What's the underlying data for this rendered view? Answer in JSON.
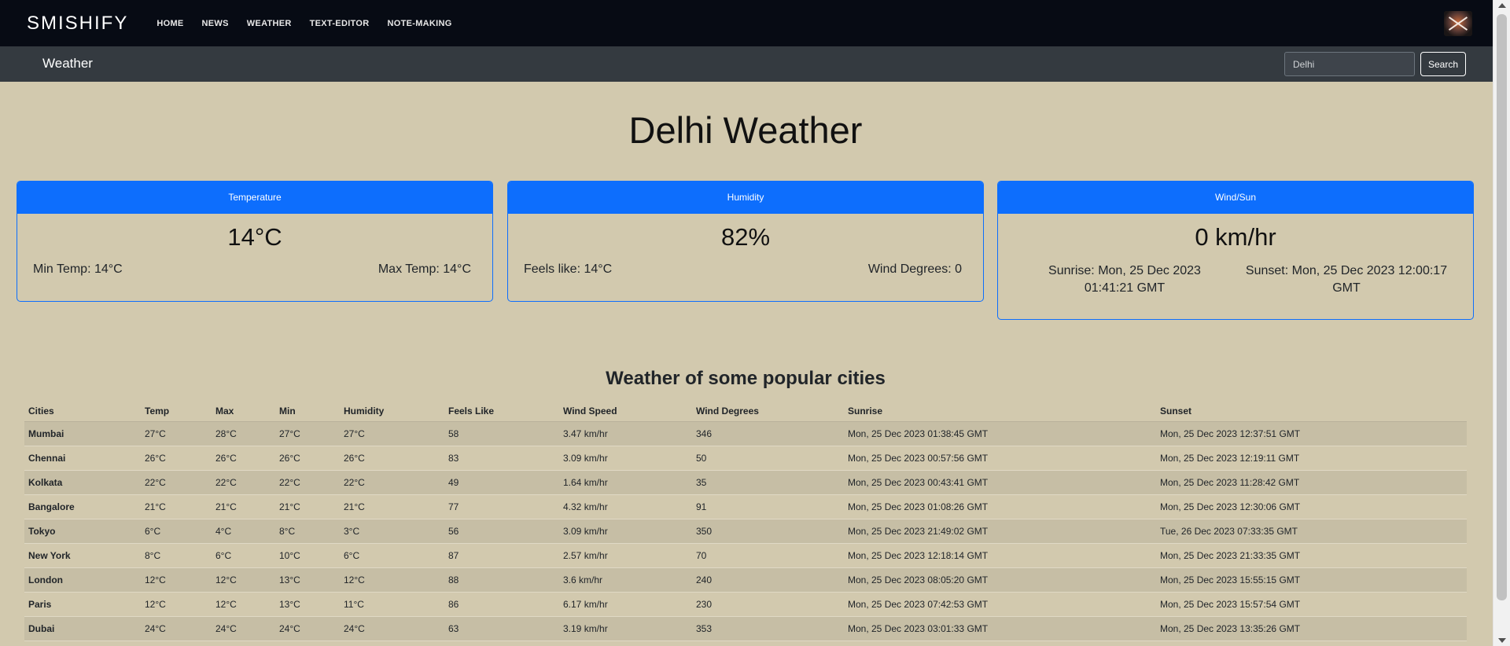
{
  "navbar": {
    "brand": "SMISHIFY",
    "links": [
      "HOME",
      "NEWS",
      "WEATHER",
      "TEXT-EDITOR",
      "NOTE-MAKING"
    ]
  },
  "subbar": {
    "title": "Weather",
    "search_value": "Delhi",
    "search_button": "Search"
  },
  "page_title": "Delhi Weather",
  "cards": {
    "temperature": {
      "header": "Temperature",
      "main": "14°C",
      "left": "Min Temp: 14°C",
      "right": "Max Temp: 14°C"
    },
    "humidity": {
      "header": "Humidity",
      "main": "82%",
      "left": "Feels like: 14°C",
      "right": "Wind Degrees: 0"
    },
    "wind": {
      "header": "Wind/Sun",
      "main": "0 km/hr",
      "left": "Sunrise: Mon, 25 Dec 2023 01:41:21 GMT",
      "right": "Sunset: Mon, 25 Dec 2023 12:00:17 GMT"
    }
  },
  "section_title": "Weather of some popular cities",
  "table": {
    "headers": [
      "Cities",
      "Temp",
      "Max",
      "Min",
      "Humidity",
      "Feels Like",
      "Wind Speed",
      "Wind Degrees",
      "Sunrise",
      "Sunset"
    ],
    "rows": [
      [
        "Mumbai",
        "27°C",
        "28°C",
        "27°C",
        "27°C",
        "58",
        "3.47 km/hr",
        "346",
        "Mon, 25 Dec 2023 01:38:45 GMT",
        "Mon, 25 Dec 2023 12:37:51 GMT"
      ],
      [
        "Chennai",
        "26°C",
        "26°C",
        "26°C",
        "26°C",
        "83",
        "3.09 km/hr",
        "50",
        "Mon, 25 Dec 2023 00:57:56 GMT",
        "Mon, 25 Dec 2023 12:19:11 GMT"
      ],
      [
        "Kolkata",
        "22°C",
        "22°C",
        "22°C",
        "22°C",
        "49",
        "1.64 km/hr",
        "35",
        "Mon, 25 Dec 2023 00:43:41 GMT",
        "Mon, 25 Dec 2023 11:28:42 GMT"
      ],
      [
        "Bangalore",
        "21°C",
        "21°C",
        "21°C",
        "21°C",
        "77",
        "4.32 km/hr",
        "91",
        "Mon, 25 Dec 2023 01:08:26 GMT",
        "Mon, 25 Dec 2023 12:30:06 GMT"
      ],
      [
        "Tokyo",
        "6°C",
        "4°C",
        "8°C",
        "3°C",
        "56",
        "3.09 km/hr",
        "350",
        "Mon, 25 Dec 2023 21:49:02 GMT",
        "Tue, 26 Dec 2023 07:33:35 GMT"
      ],
      [
        "New York",
        "8°C",
        "6°C",
        "10°C",
        "6°C",
        "87",
        "2.57 km/hr",
        "70",
        "Mon, 25 Dec 2023 12:18:14 GMT",
        "Mon, 25 Dec 2023 21:33:35 GMT"
      ],
      [
        "London",
        "12°C",
        "12°C",
        "13°C",
        "12°C",
        "88",
        "3.6 km/hr",
        "240",
        "Mon, 25 Dec 2023 08:05:20 GMT",
        "Mon, 25 Dec 2023 15:55:15 GMT"
      ],
      [
        "Paris",
        "12°C",
        "12°C",
        "13°C",
        "11°C",
        "86",
        "6.17 km/hr",
        "230",
        "Mon, 25 Dec 2023 07:42:53 GMT",
        "Mon, 25 Dec 2023 15:57:54 GMT"
      ],
      [
        "Dubai",
        "24°C",
        "24°C",
        "24°C",
        "24°C",
        "63",
        "3.19 km/hr",
        "353",
        "Mon, 25 Dec 2023 03:01:33 GMT",
        "Mon, 25 Dec 2023 13:35:26 GMT"
      ]
    ]
  },
  "colors": {
    "background": "#d2c9ae",
    "navbar": "#070b14",
    "subbar": "#343a40",
    "accent": "#0d6efd"
  },
  "icons": {
    "avatar": "crossed-swords-avatar"
  }
}
